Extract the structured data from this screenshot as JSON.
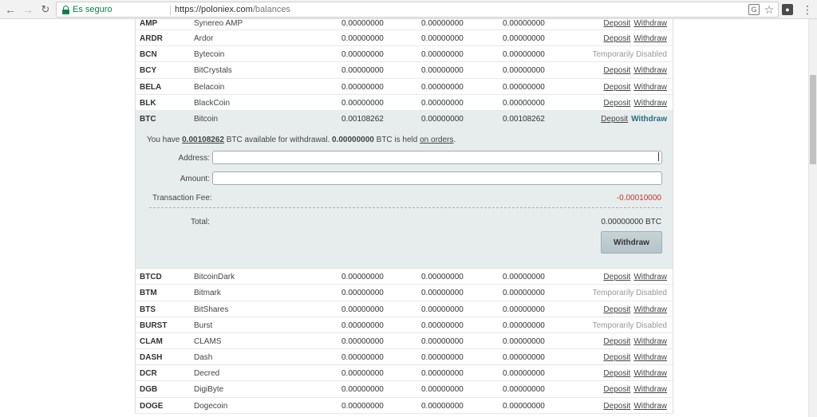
{
  "browser": {
    "secure_label": "Es seguro",
    "url_host": "https://poloniex.com",
    "url_path": "/balances"
  },
  "rows_top": [
    {
      "code": "AMP",
      "name": "Synereo AMP",
      "balance": "0.00000000",
      "on_orders": "0.00000000",
      "btc_value": "0.00000000",
      "deposit": "Deposit",
      "withdraw": "Withdraw"
    },
    {
      "code": "ARDR",
      "name": "Ardor",
      "balance": "0.00000000",
      "on_orders": "0.00000000",
      "btc_value": "0.00000000",
      "deposit": "Deposit",
      "withdraw": "Withdraw"
    },
    {
      "code": "BCN",
      "name": "Bytecoin",
      "balance": "0.00000000",
      "on_orders": "0.00000000",
      "btc_value": "0.00000000",
      "status": "Temporarily Disabled"
    },
    {
      "code": "BCY",
      "name": "BitCrystals",
      "balance": "0.00000000",
      "on_orders": "0.00000000",
      "btc_value": "0.00000000",
      "deposit": "Deposit",
      "withdraw": "Withdraw"
    },
    {
      "code": "BELA",
      "name": "Belacoin",
      "balance": "0.00000000",
      "on_orders": "0.00000000",
      "btc_value": "0.00000000",
      "deposit": "Deposit",
      "withdraw": "Withdraw"
    },
    {
      "code": "BLK",
      "name": "BlackCoin",
      "balance": "0.00000000",
      "on_orders": "0.00000000",
      "btc_value": "0.00000000",
      "deposit": "Deposit",
      "withdraw": "Withdraw"
    }
  ],
  "selected_row": {
    "code": "BTC",
    "name": "Bitcoin",
    "balance": "0.00108262",
    "on_orders": "0.00000000",
    "btc_value": "0.00108262",
    "deposit": "Deposit",
    "withdraw": "Withdraw"
  },
  "withdraw_panel": {
    "avail_prefix": "You have",
    "avail_amount": "0.00108262",
    "avail_mid": "BTC available for withdrawal.",
    "held_amount": "0.00000000",
    "held_mid": "BTC is held",
    "orders_link": "on orders",
    "period": ".",
    "address_label": "Address:",
    "address_value": "",
    "amount_label": "Amount:",
    "amount_value": "",
    "fee_label": "Transaction Fee:",
    "fee_value": "-0.00010000",
    "total_label": "Total:",
    "total_value": "0.00000000 BTC",
    "button_label": "Withdraw"
  },
  "rows_bottom": [
    {
      "code": "BTCD",
      "name": "BitcoinDark",
      "balance": "0.00000000",
      "on_orders": "0.00000000",
      "btc_value": "0.00000000",
      "deposit": "Deposit",
      "withdraw": "Withdraw"
    },
    {
      "code": "BTM",
      "name": "Bitmark",
      "balance": "0.00000000",
      "on_orders": "0.00000000",
      "btc_value": "0.00000000",
      "status": "Temporarily Disabled"
    },
    {
      "code": "BTS",
      "name": "BitShares",
      "balance": "0.00000000",
      "on_orders": "0.00000000",
      "btc_value": "0.00000000",
      "deposit": "Deposit",
      "withdraw": "Withdraw"
    },
    {
      "code": "BURST",
      "name": "Burst",
      "balance": "0.00000000",
      "on_orders": "0.00000000",
      "btc_value": "0.00000000",
      "status": "Temporarily Disabled"
    },
    {
      "code": "CLAM",
      "name": "CLAMS",
      "balance": "0.00000000",
      "on_orders": "0.00000000",
      "btc_value": "0.00000000",
      "deposit": "Deposit",
      "withdraw": "Withdraw"
    },
    {
      "code": "DASH",
      "name": "Dash",
      "balance": "0.00000000",
      "on_orders": "0.00000000",
      "btc_value": "0.00000000",
      "deposit": "Deposit",
      "withdraw": "Withdraw"
    },
    {
      "code": "DCR",
      "name": "Decred",
      "balance": "0.00000000",
      "on_orders": "0.00000000",
      "btc_value": "0.00000000",
      "deposit": "Deposit",
      "withdraw": "Withdraw"
    },
    {
      "code": "DGB",
      "name": "DigiByte",
      "balance": "0.00000000",
      "on_orders": "0.00000000",
      "btc_value": "0.00000000",
      "deposit": "Deposit",
      "withdraw": "Withdraw"
    },
    {
      "code": "DOGE",
      "name": "Dogecoin",
      "balance": "0.00000000",
      "on_orders": "0.00000000",
      "btc_value": "0.00000000",
      "deposit": "Deposit",
      "withdraw": "Withdraw"
    }
  ]
}
